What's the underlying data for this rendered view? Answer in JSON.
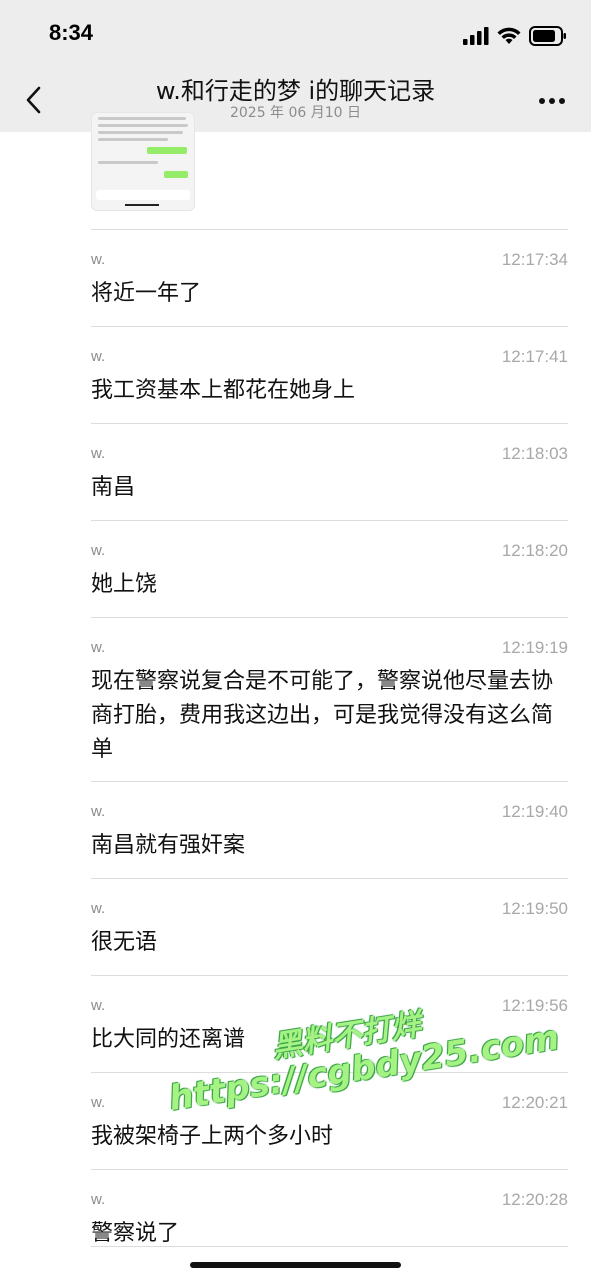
{
  "status": {
    "time": "8:34"
  },
  "header": {
    "title": "w.和行走的梦 i的聊天记录",
    "subtitle": "2025 年 06 月10 日"
  },
  "messages": [
    {
      "sender": "w.",
      "time": "12:17:34",
      "text": "将近一年了"
    },
    {
      "sender": "w.",
      "time": "12:17:41",
      "text": "我工资基本上都花在她身上"
    },
    {
      "sender": "w.",
      "time": "12:18:03",
      "text": "南昌"
    },
    {
      "sender": "w.",
      "time": "12:18:20",
      "text": "她上饶"
    },
    {
      "sender": "w.",
      "time": "12:19:19",
      "text": "现在警察说复合是不可能了，警察说他尽量去协商打胎，费用我这边出，可是我觉得没有这么简单"
    },
    {
      "sender": "w.",
      "time": "12:19:40",
      "text": "南昌就有强奸案"
    },
    {
      "sender": "w.",
      "time": "12:19:50",
      "text": "很无语"
    },
    {
      "sender": "w.",
      "time": "12:19:56",
      "text": "比大同的还离谱"
    },
    {
      "sender": "w.",
      "time": "12:20:21",
      "text": "我被架椅子上两个多小时"
    },
    {
      "sender": "w.",
      "time": "12:20:28",
      "text": "警察说了"
    }
  ],
  "watermark": {
    "line1": "黑料不打烊",
    "line2": "https://cgbdy25.com"
  },
  "colors": {
    "bar_bg": "#ededed",
    "divider": "#dcdcdc",
    "watermark": "#9df27a"
  }
}
